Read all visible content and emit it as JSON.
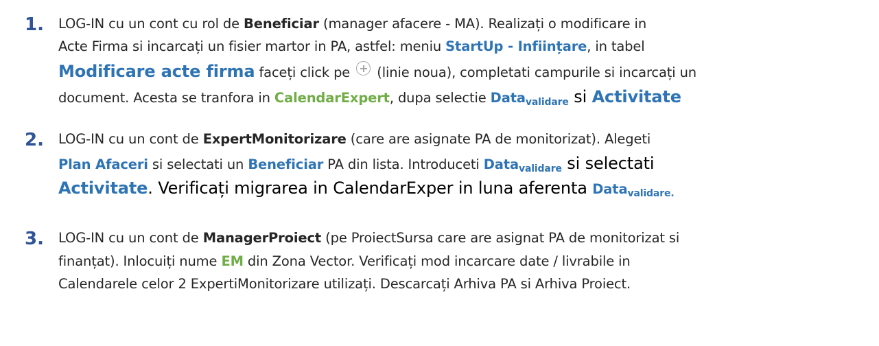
{
  "items": [
    {
      "number": "1.",
      "line1": {
        "t1": "LOG-IN cu un cont cu rol de ",
        "b1": "Beneficiar",
        "t2": " (manager afacere - MA). Realizați o modificare in"
      },
      "line2": {
        "t1": "Acte Firma si incarcați un fisier martor in PA, astfel:  meniu ",
        "b1": "StartUp - Inființare",
        "t2": ", in tabel"
      },
      "line3": {
        "b1": "Modificare acte firma",
        "t1": " faceți click pe ",
        "t2": " (linie noua), completati campurile si incarcați un"
      },
      "line4": {
        "t1": "document. Acesta se tranfora in ",
        "g1": "CalendarExpert",
        "t2": ", dupa selectie ",
        "b1": "Data",
        "sub1": "validare",
        "t3": " si ",
        "b2": "Activitate"
      }
    },
    {
      "number": "2.",
      "line1": {
        "t1": "LOG-IN cu un cont de ",
        "b1": "ExpertMonitorizare",
        "t2": " (care are asignate PA de monitorizat). Alegeti"
      },
      "line2": {
        "b1": "Plan Afaceri",
        "t1": " si selectati un ",
        "b2": "Beneficiar",
        "t2": " PA din lista. Introduceti ",
        "b3": "Data",
        "sub1": "validare",
        "t3": " si selectati"
      },
      "line3": {
        "b1": "Activitate",
        "t1": ". Verificați migrarea in CalendarExper in luna aferenta ",
        "b2": "Data",
        "sub1": "validare."
      }
    },
    {
      "number": "3.",
      "line1": {
        "t1": "LOG-IN cu un cont de ",
        "b1": "ManagerProiect",
        "t2": " (pe ProiectSursa care are asignat PA de monitorizat si"
      },
      "line2": {
        "t1": "finanțat). Inlocuiți nume ",
        "g1": "EM",
        "t2": " din Zona Vector. Verificați mod incarcare date / livrabile in"
      },
      "line3": {
        "t1": "Calendarele celor 2 ExpertiMonitorizare utilizați. Descarcați Arhiva PA si Arhiva Proiect."
      }
    }
  ],
  "icons": {
    "add_row": "plus-circle-icon"
  },
  "colors": {
    "number": "#2f5496",
    "link_blue": "#2e74b5",
    "link_green": "#70ad47",
    "body_text": "#262626"
  }
}
